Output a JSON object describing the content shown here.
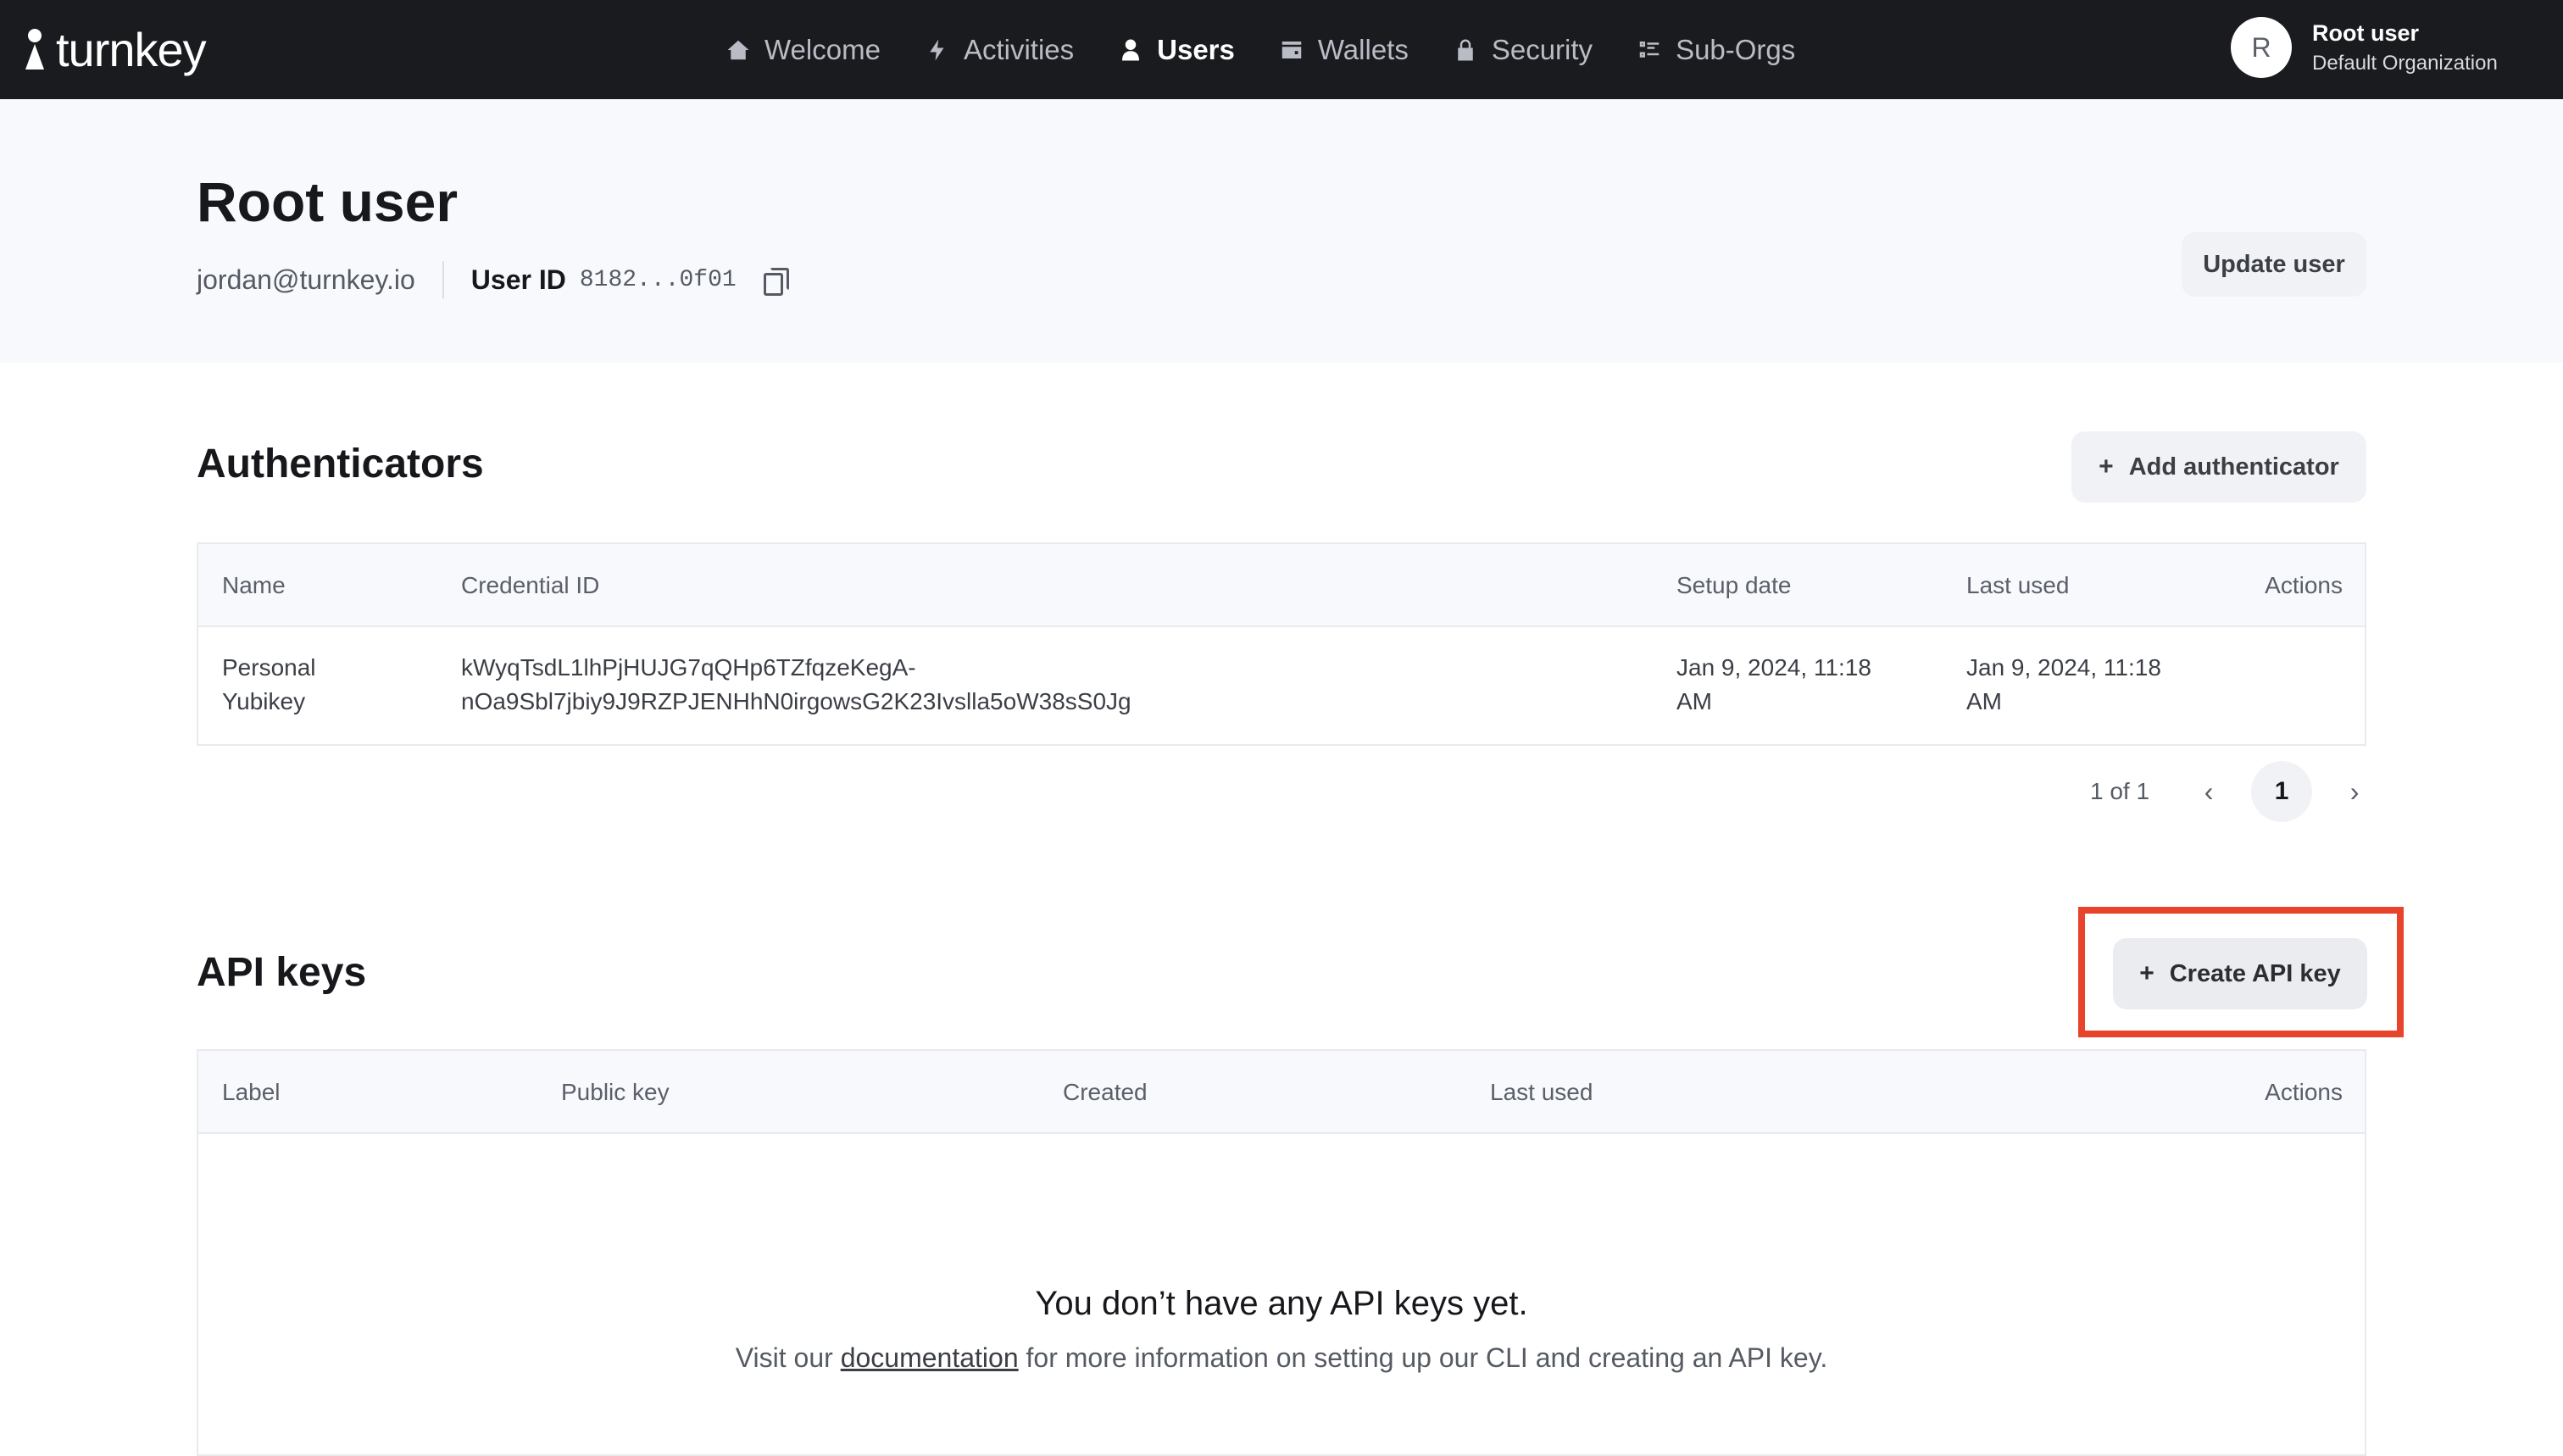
{
  "brand": {
    "name": "turnkey"
  },
  "nav": {
    "items": [
      {
        "label": "Welcome",
        "icon": "home-icon",
        "active": false
      },
      {
        "label": "Activities",
        "icon": "bolt-icon",
        "active": false
      },
      {
        "label": "Users",
        "icon": "user-icon",
        "active": true
      },
      {
        "label": "Wallets",
        "icon": "wallet-icon",
        "active": false
      },
      {
        "label": "Security",
        "icon": "lock-icon",
        "active": false
      },
      {
        "label": "Sub-Orgs",
        "icon": "list-icon",
        "active": false
      }
    ]
  },
  "profile": {
    "initial": "R",
    "name": "Root user",
    "org": "Default Organization"
  },
  "user": {
    "title": "Root user",
    "email": "jordan@turnkey.io",
    "user_id_label": "User ID",
    "user_id": "8182...0f01",
    "update_label": "Update user"
  },
  "authenticators": {
    "title": "Authenticators",
    "add_label": "Add authenticator",
    "columns": [
      "Name",
      "Credential ID",
      "Setup date",
      "Last used",
      "Actions"
    ],
    "rows": [
      {
        "name_line1": "Personal",
        "name_line2": "Yubikey",
        "credential_line1": "kWyqTsdL1lhPjHUJG7qQHp6TZfqzeKegA-",
        "credential_line2": "nOa9Sbl7jbiy9J9RZPJENHhN0irgowsG2K23Ivslla5oW38sS0Jg",
        "setup_line1": "Jan 9, 2024, 11:18",
        "setup_line2": "AM",
        "last_line1": "Jan 9, 2024, 11:18",
        "last_line2": "AM"
      }
    ],
    "pager": {
      "info": "1 of 1",
      "current": "1",
      "prev": "‹",
      "next": "›"
    }
  },
  "api_keys": {
    "title": "API keys",
    "create_label": "Create API key",
    "columns": [
      "Label",
      "Public key",
      "Created",
      "Last used",
      "Actions"
    ],
    "empty_title": "You don’t have any API keys yet.",
    "empty_prefix": "Visit our ",
    "empty_link": "documentation",
    "empty_suffix": " for more information on setting up our CLI and creating an API key."
  },
  "colors": {
    "topbar": "#1a1b1f",
    "hero": "#f8f9fd",
    "highlight": "#e8432b"
  }
}
